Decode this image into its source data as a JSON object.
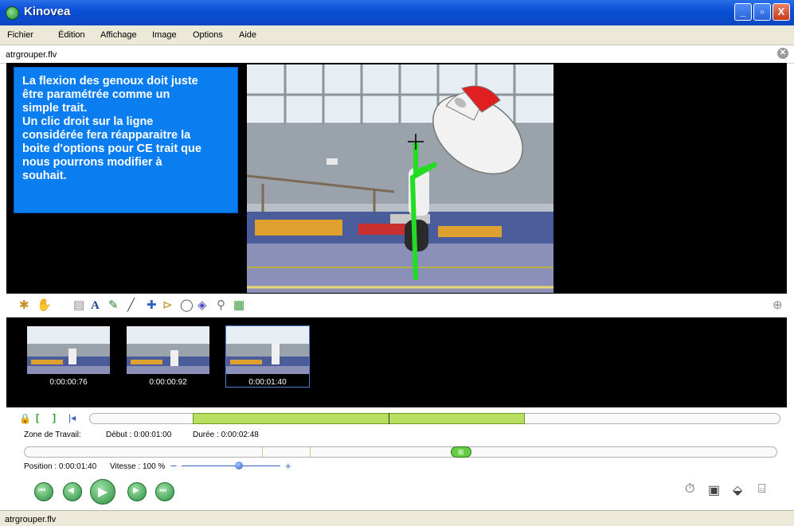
{
  "window": {
    "title": "Kinovea",
    "buttons": {
      "minimize": "_",
      "maximize": "▫",
      "close": "X"
    }
  },
  "menu": [
    "Fichier",
    "Édition",
    "Affichage",
    "Image",
    "Options",
    "Aide"
  ],
  "file_tab": {
    "name": "atrgrouper.flv"
  },
  "info_box": {
    "lines": [
      "La flexion des genoux doit juste",
      "être paramétrée comme un",
      "simple trait.",
      "Un clic droit sur la ligne",
      "considérée fera réapparaitre la",
      "boite d'options pour CE trait que",
      "nous pourrons modifier  à",
      "souhait."
    ]
  },
  "toolbar": {
    "icons": [
      "new-key-image-icon",
      "hand-icon",
      "comment-icon",
      "text-icon",
      "pencil-icon",
      "line-icon",
      "cross-icon",
      "angle-icon",
      "chrono-icon",
      "grid-icon",
      "magnifier-icon",
      "colors-icon"
    ],
    "text_tool_label": "A"
  },
  "thumbnails": [
    {
      "time": "0:00:00:76"
    },
    {
      "time": "0:00:00:92"
    },
    {
      "time": "0:00:01:40"
    }
  ],
  "workzone": {
    "label": "Zone de Travail:",
    "start": "Début : 0:00:01:00",
    "duration": "Durée : 0:00:02:48",
    "start_fraction": 0.15,
    "end_fraction": 0.63
  },
  "position": {
    "label": "Position : 0:00:01:40",
    "speed": "Vitesse : 100 %",
    "speed_minus": "−",
    "speed_plus": "+",
    "fraction": 0.58,
    "speed_fraction": 0.58
  },
  "status": {
    "text": "atrgrouper.flv"
  },
  "colors": {
    "titlebar": "#0b4fd6",
    "info_box": "#0a7ef0",
    "workzone": "#b8e060",
    "playbutton": "#2a9040"
  }
}
